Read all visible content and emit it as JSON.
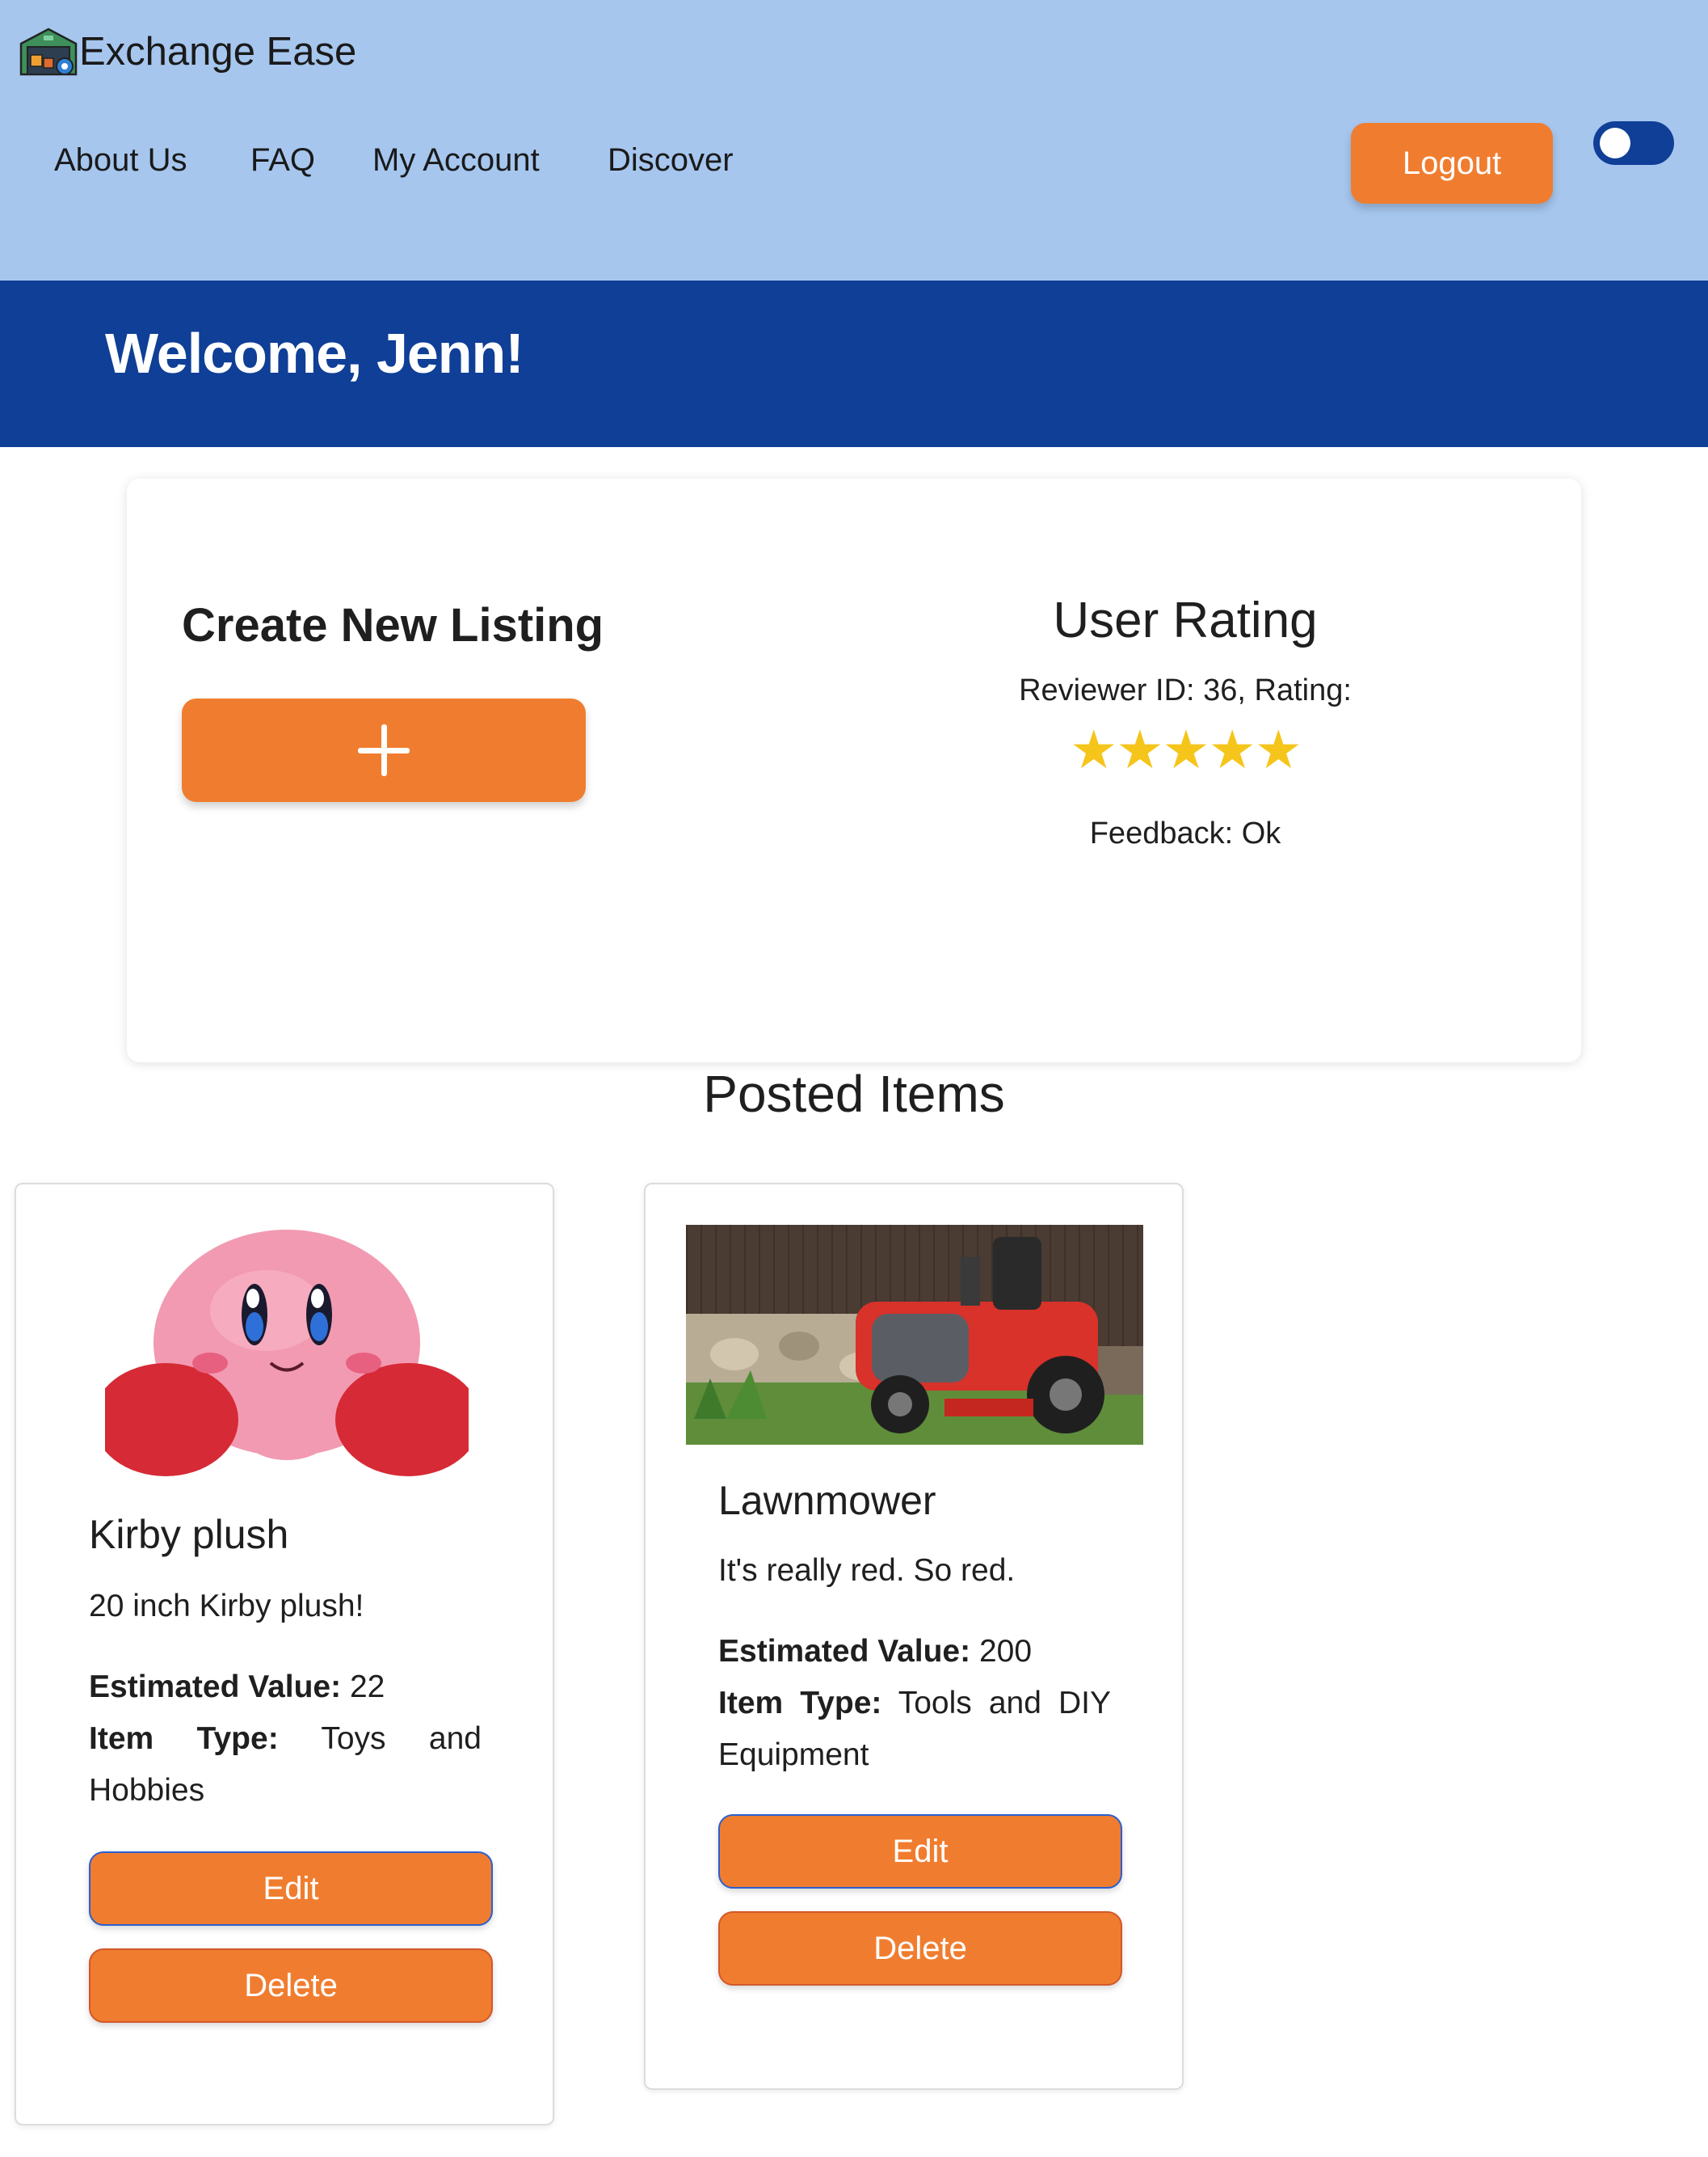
{
  "brand": {
    "name": "Exchange Ease",
    "logo_icon": "warehouse-logo-icon"
  },
  "nav": {
    "items": [
      {
        "label": "About Us"
      },
      {
        "label": "FAQ"
      },
      {
        "label": "My Account"
      },
      {
        "label": "Discover"
      }
    ],
    "logout_label": "Logout",
    "theme_toggle": {
      "on": true
    }
  },
  "welcome": {
    "text": "Welcome, Jenn!"
  },
  "create_listing": {
    "title": "Create New Listing",
    "button_icon": "plus-icon"
  },
  "user_rating": {
    "title": "User Rating",
    "reviewer_text": "Reviewer ID: 36, Rating:",
    "stars_text": "★★★★★",
    "stars_count": 5,
    "feedback_text": "Feedback: Ok"
  },
  "posted_items": {
    "title": "Posted Items",
    "items": [
      {
        "image_icon": "kirby-plush-image",
        "title": "Kirby plush",
        "description": "20 inch Kirby plush!",
        "value_label": "Estimated Value:",
        "value": "22",
        "type_label": "Item Type:",
        "type": "Toys and Hobbies",
        "edit_label": "Edit",
        "delete_label": "Delete"
      },
      {
        "image_icon": "lawnmower-image",
        "title": "Lawnmower",
        "description": "It's really red. So red.",
        "value_label": "Estimated Value:",
        "value": "200",
        "type_label": "Item Type:",
        "type": "Tools and DIY Equipment",
        "edit_label": "Edit",
        "delete_label": "Delete"
      }
    ]
  },
  "colors": {
    "header_bg": "#a6c6ee",
    "welcome_bg": "#0f3f96",
    "accent_orange": "#f07d2f",
    "star_yellow": "#f5c51b"
  }
}
